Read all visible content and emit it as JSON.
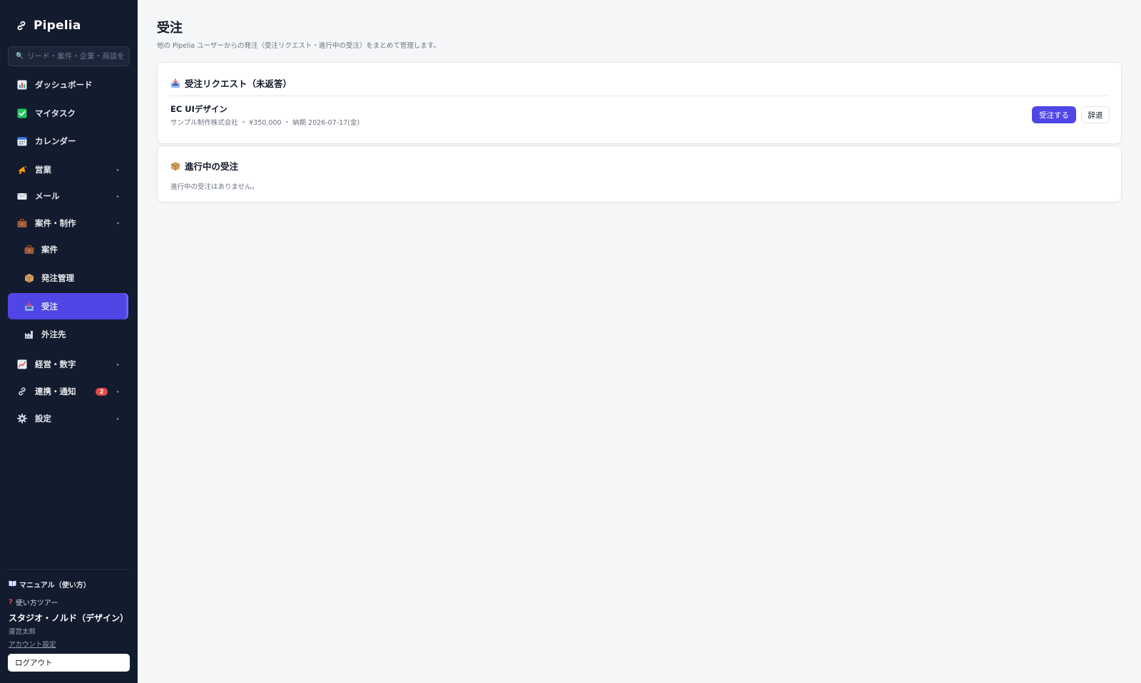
{
  "app": {
    "name": "Pipelia"
  },
  "search": {
    "placeholder": "リード・案件・企業・商談を"
  },
  "sidebar": {
    "items": [
      {
        "label": "ダッシュボード",
        "icon": "bar-chart-icon"
      },
      {
        "label": "マイタスク",
        "icon": "check-box-icon"
      },
      {
        "label": "カレンダー",
        "icon": "calendar-icon"
      },
      {
        "label": "営業",
        "icon": "megaphone-icon"
      },
      {
        "label": "メール",
        "icon": "envelope-icon"
      },
      {
        "label": "案件・制作",
        "icon": "briefcase-icon"
      },
      {
        "label": "案件",
        "icon": "briefcase-icon"
      },
      {
        "label": "発注管理",
        "icon": "package-icon"
      },
      {
        "label": "受注",
        "icon": "inbox-tray-icon",
        "active": true
      },
      {
        "label": "外注先",
        "icon": "factory-icon"
      },
      {
        "label": "経営・数字",
        "icon": "trend-chart-icon"
      },
      {
        "label": "連携・通知",
        "icon": "link-icon",
        "badge": "2"
      },
      {
        "label": "設定",
        "icon": "gear-icon"
      }
    ],
    "manual_label": "マニュアル（使い方）",
    "tour_label": "使い方ツアー",
    "org_name": "スタジオ・ノルド（デザイン）",
    "user_name": "運営太郎",
    "account_label": "アカウント設定",
    "logout_label": "ログアウト"
  },
  "main": {
    "title": "受注",
    "subtitle": "他の Pipelia ユーザーからの発注（受注リクエスト・進行中の受注）をまとめて管理します。",
    "requests": {
      "title": "受注リクエスト（未返答）",
      "items": [
        {
          "title": "EC UIデザイン",
          "meta": "サンプル制作株式会社 ・ ¥350,000 ・ 納期 2026-07-17(金)",
          "accept_label": "受注する",
          "decline_label": "辞退"
        }
      ]
    },
    "in_progress": {
      "title": "進行中の受注",
      "empty_text": "進行中の受注はありません。"
    }
  },
  "colors": {
    "sidebar_bg": "#131b2e",
    "accent": "#4f46e5",
    "badge": "#e24a4a",
    "page_bg": "#f5f6f8"
  }
}
